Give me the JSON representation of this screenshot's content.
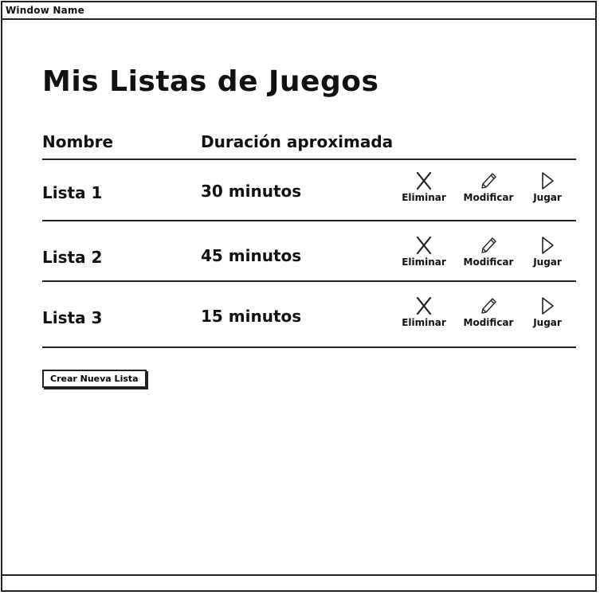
{
  "window": {
    "title": "Window Name"
  },
  "page": {
    "title": "Mis Listas de Juegos"
  },
  "table": {
    "headers": {
      "name": "Nombre",
      "duration": "Duración aproximada"
    },
    "rows": [
      {
        "name": "Lista 1",
        "duration": "30 minutos"
      },
      {
        "name": "Lista 2",
        "duration": "45 minutos"
      },
      {
        "name": "Lista 3",
        "duration": "15 minutos"
      }
    ],
    "actions": {
      "delete": "Eliminar",
      "edit": "Modificar",
      "play": "Jugar"
    },
    "icons": {
      "delete": "close-icon",
      "edit": "pencil-icon",
      "play": "play-icon"
    }
  },
  "create_button": {
    "label": "Crear Nueva Lista"
  }
}
